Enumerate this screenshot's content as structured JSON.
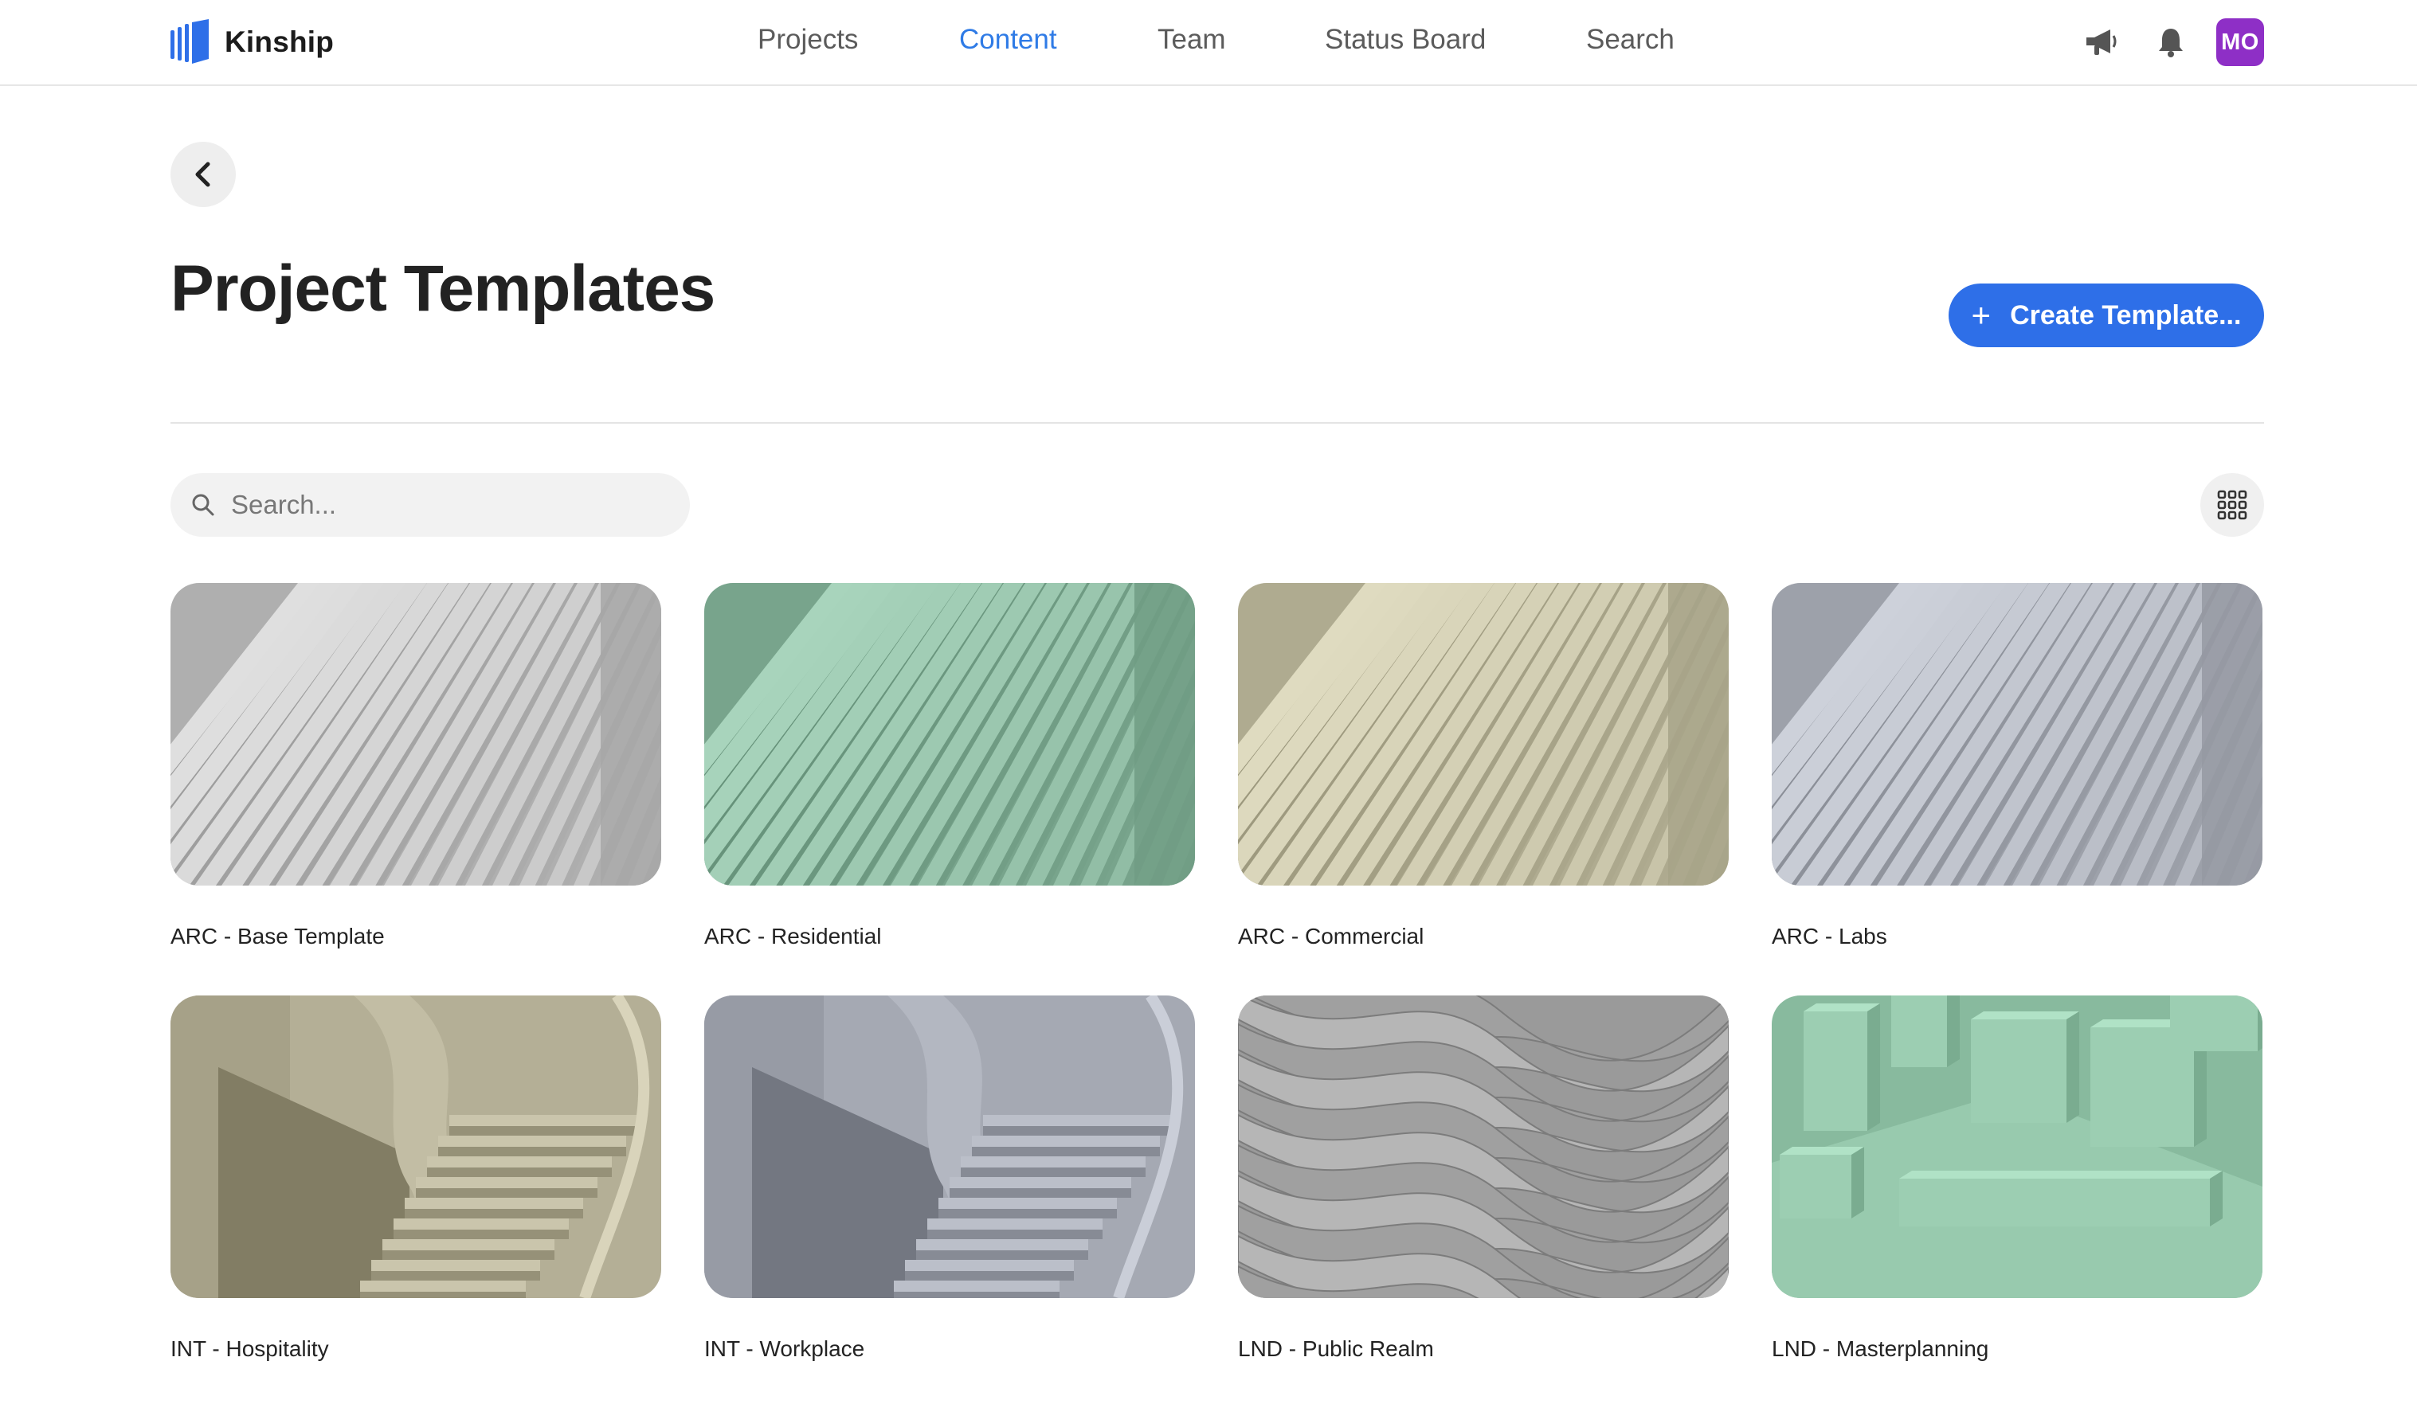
{
  "app": {
    "name": "Kinship",
    "brand_color": "#2e6fe8"
  },
  "nav": {
    "items": [
      {
        "label": "Projects",
        "active": false
      },
      {
        "label": "Content",
        "active": true
      },
      {
        "label": "Team",
        "active": false
      },
      {
        "label": "Status Board",
        "active": false
      },
      {
        "label": "Search",
        "active": false
      }
    ],
    "icons": [
      "megaphone-icon",
      "bell-icon"
    ],
    "avatar_initials": "MO",
    "avatar_color": "#8e2fc6"
  },
  "page": {
    "back_icon": "chevron-left-icon",
    "title": "Project Templates",
    "create_button": {
      "icon": "plus-icon",
      "label": "Create Template..."
    }
  },
  "toolbar": {
    "search_placeholder": "Search...",
    "search_value": "",
    "view_toggle_icon": "grid-view-icon"
  },
  "templates": [
    {
      "label": "ARC - Base Template",
      "thumb_style": "ribs",
      "tint": "#b9b9b9"
    },
    {
      "label": "ARC - Residential",
      "thumb_style": "ribs",
      "tint": "#82ae96"
    },
    {
      "label": "ARC - Commercial",
      "thumb_style": "ribs",
      "tint": "#b9b59a"
    },
    {
      "label": "ARC - Labs",
      "thumb_style": "ribs",
      "tint": "#a7abb4"
    },
    {
      "label": "INT - Hospitality",
      "thumb_style": "stairs",
      "tint": "#aca78e"
    },
    {
      "label": "INT - Workplace",
      "thumb_style": "stairs",
      "tint": "#9da1ab"
    },
    {
      "label": "LND - Public Realm",
      "thumb_style": "contours",
      "tint": "#a4a4a4"
    },
    {
      "label": "LND - Masterplanning",
      "thumb_style": "blocks",
      "tint": "#8ec0a4"
    }
  ]
}
